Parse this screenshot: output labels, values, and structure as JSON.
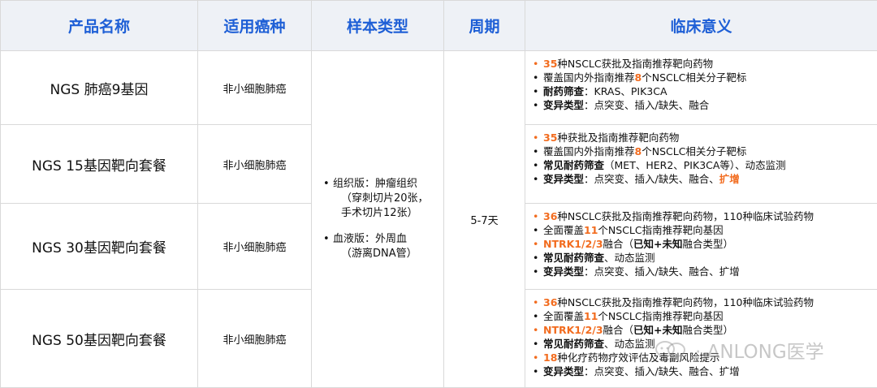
{
  "headers": [
    "产品名称",
    "适用癌种",
    "样本类型",
    "周期",
    "临床意义"
  ],
  "sample": {
    "tissue_line1": "组织版：肿瘤组织",
    "tissue_line2": "（穿刺切片20张，",
    "tissue_line3": "手术切片12张）",
    "blood_line1": "血液版：外周血",
    "blood_line2": "（游离DNA管）"
  },
  "period": "5-7天",
  "rows": [
    {
      "name": "NGS 肺癌9基因",
      "cancer": "非小细胞肺癌",
      "sig": {
        "l1a": "35",
        "l1b": "种NSCLC获批及指南推荐靶向药物",
        "l2a": "覆盖国内外指南推荐",
        "l2b": "8",
        "l2c": "个NSCLC相关分子靶标",
        "l3a": "耐药筛查",
        "l3b": "：KRAS、PIK3CA",
        "l4a": "变异类型",
        "l4b": "：点突变、插入/缺失、融合"
      }
    },
    {
      "name": "NGS 15基因靶向套餐",
      "cancer": "非小细胞肺癌",
      "sig": {
        "l1a": "35",
        "l1b": "种获批及指南推荐靶向药物",
        "l2a": "覆盖国内外指南推荐",
        "l2b": "8",
        "l2c": "个NSCLC相关分子靶标",
        "l3a": "常见耐药筛查",
        "l3b": "（MET、HER2、PIK3CA等）、动态监测",
        "l4a": "变异类型",
        "l4b": "：点突变、插入/缺失、融合、",
        "l4c": "扩增"
      }
    },
    {
      "name": "NGS 30基因靶向套餐",
      "cancer": "非小细胞肺癌",
      "sig": {
        "l1a": "36",
        "l1b": "种NSCLC获批及指南推荐靶向药物，110种临床试验药物",
        "l2a": "全面覆盖",
        "l2b": "11",
        "l2c": "个NSCLC指南推荐靶向基因",
        "l3a": "NTRK1/2/3",
        "l3b": "融合（",
        "l3c": "已知+未知",
        "l3d": "融合类型）",
        "l4a": "常见耐药筛查",
        "l4b": "、动态监测",
        "l5a": "变异类型",
        "l5b": "：点突变、插入/缺失、融合、扩增"
      }
    },
    {
      "name": "NGS 50基因靶向套餐",
      "cancer": "非小细胞肺癌",
      "sig": {
        "l1a": "36",
        "l1b": "种NSCLC获批及指南推荐靶向药物，110种临床试验药物",
        "l2a": "全面覆盖",
        "l2b": "11",
        "l2c": "个NSCLC指南推荐靶向基因",
        "l3a": "NTRK1/2/3",
        "l3b": "融合（",
        "l3c": "已知+未知",
        "l3d": "融合类型）",
        "l4a": "常见耐药筛查",
        "l4b": "、动态监测",
        "l5a": "18",
        "l5b": "种化疗药物疗效评估及毒副风险提示",
        "l6a": "变异类型",
        "l6b": "：点突变、插入/缺失、融合、扩增"
      }
    }
  ],
  "watermark": "· ANLONG医学",
  "colors": {
    "header_text": "#1e5fd6",
    "header_bg": "#eef1f6",
    "highlight": "#f26c1f",
    "border": "#d9d9d9"
  }
}
